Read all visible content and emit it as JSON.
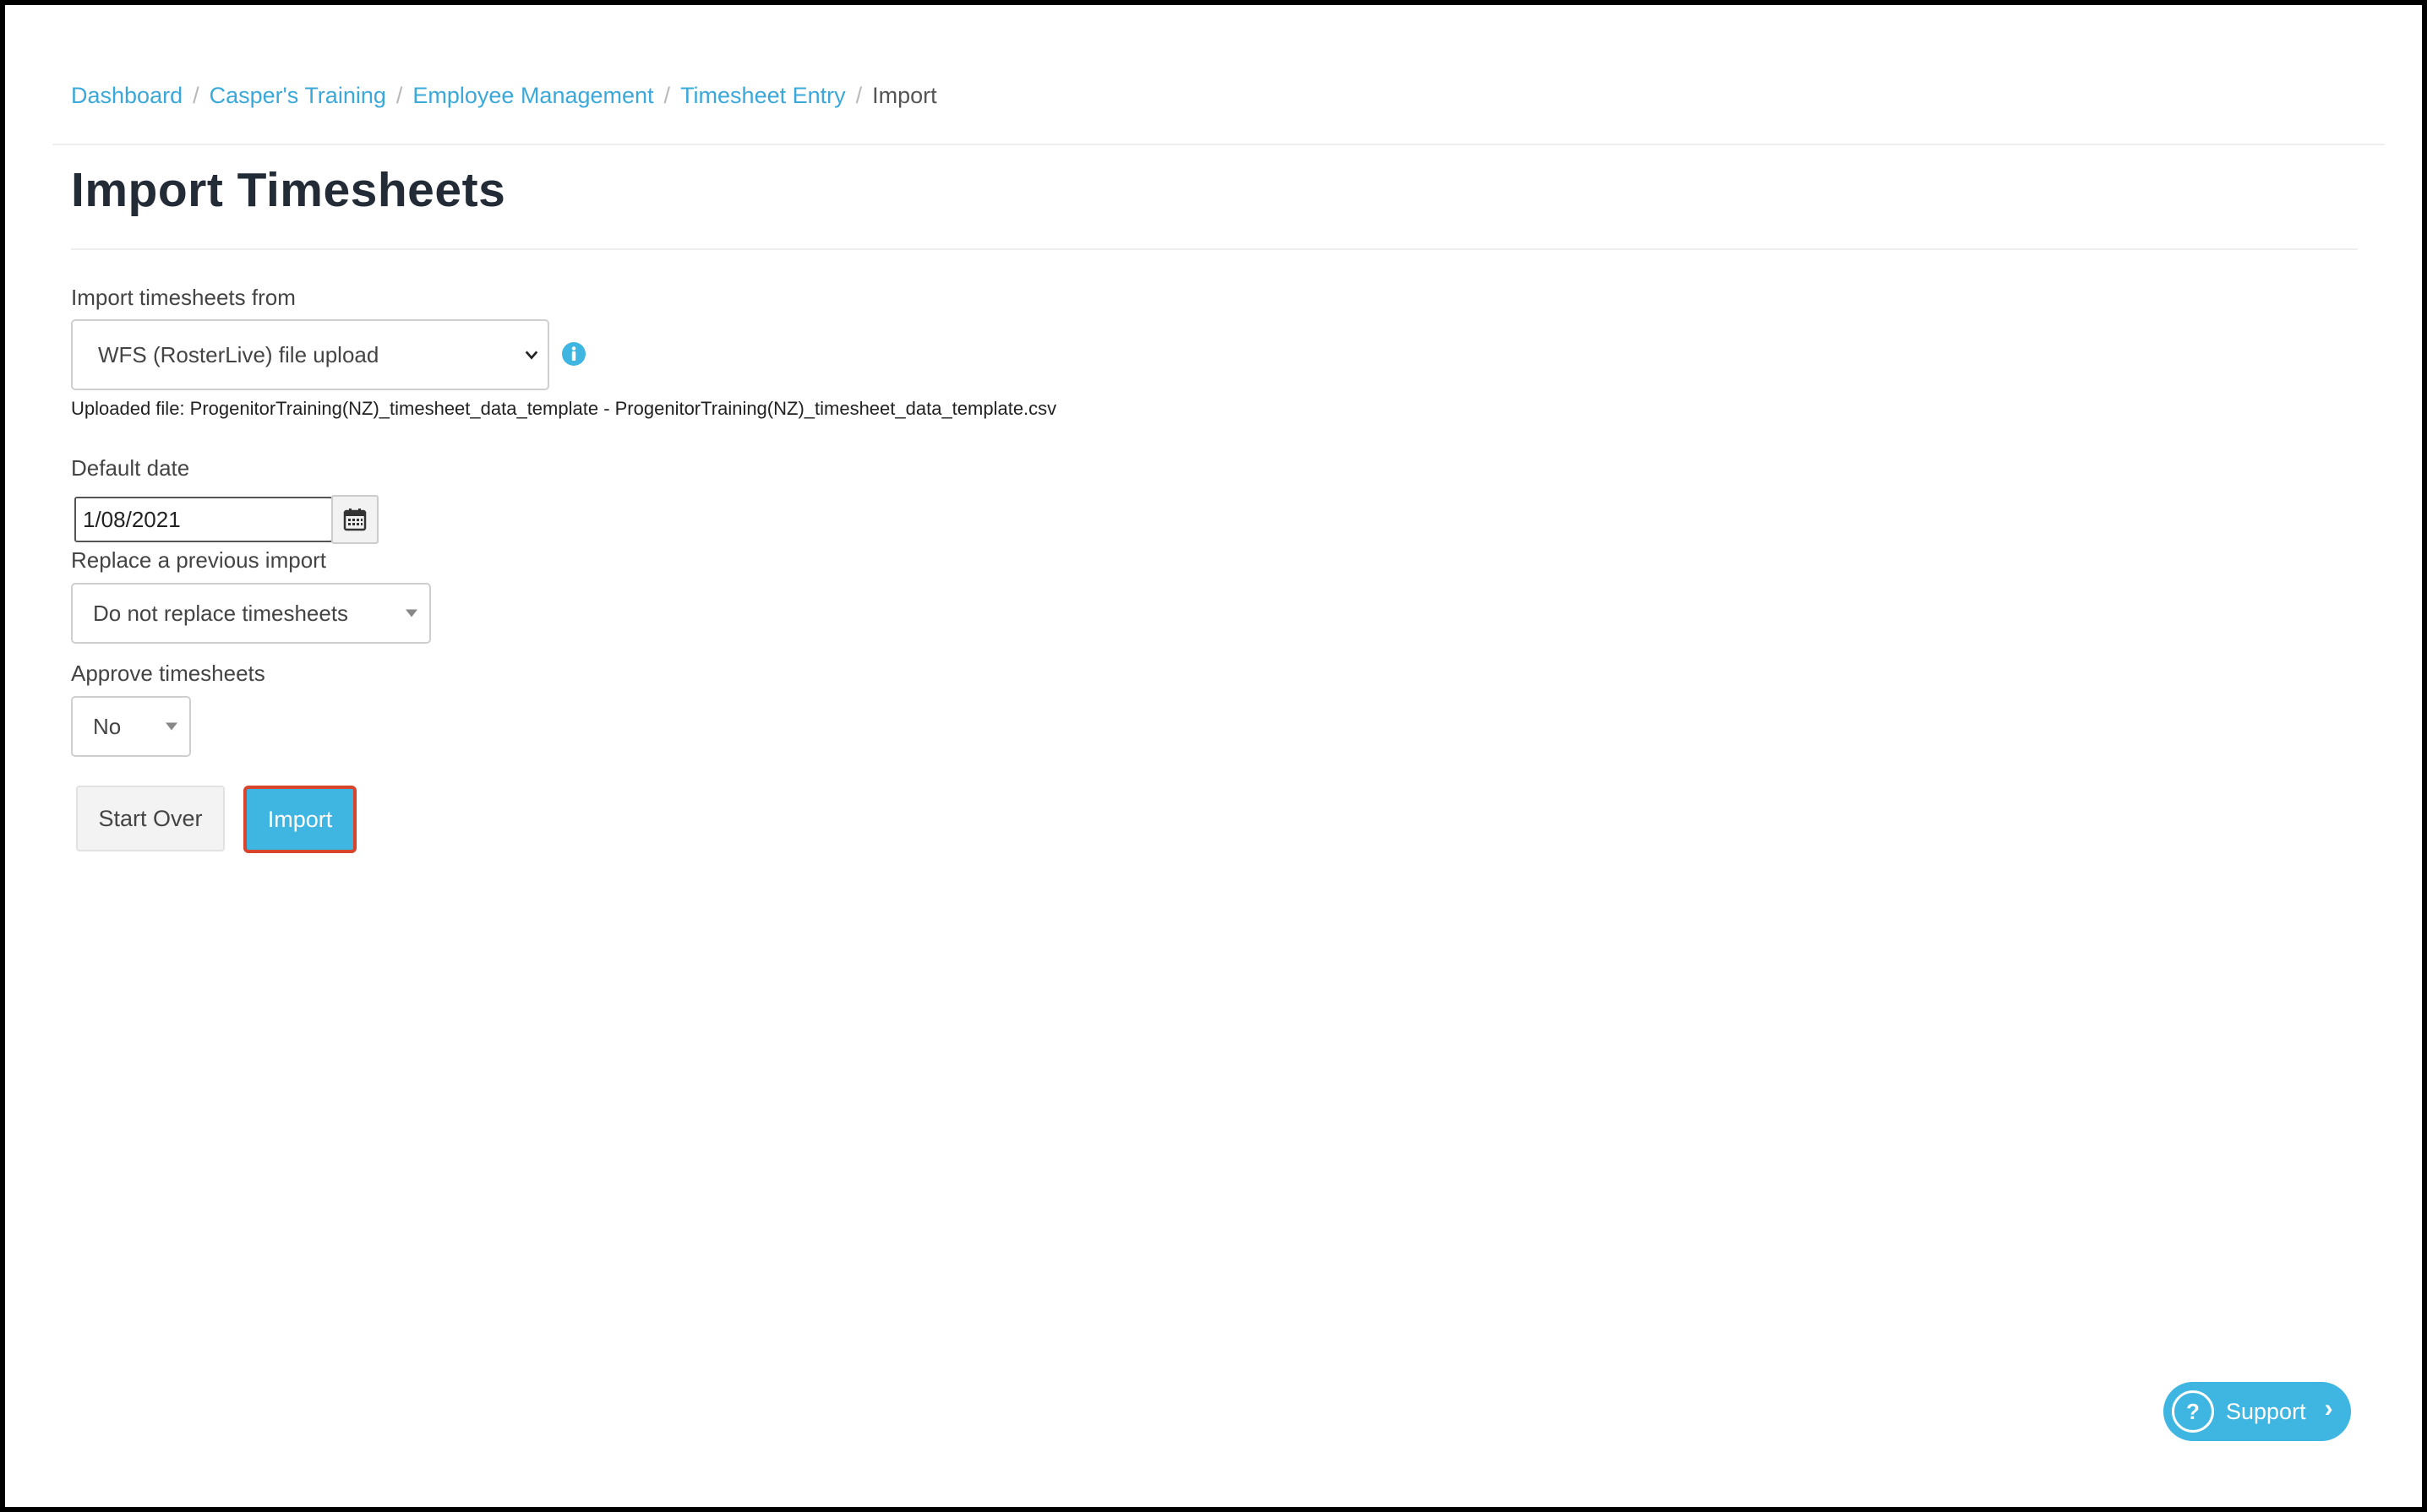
{
  "breadcrumb": {
    "items": [
      "Dashboard",
      "Casper's Training",
      "Employee Management",
      "Timesheet Entry"
    ],
    "current": "Import",
    "separator": "/"
  },
  "page": {
    "title": "Import Timesheets"
  },
  "form": {
    "source_label": "Import timesheets from",
    "source_value": "WFS (RosterLive) file upload",
    "uploaded_file": "Uploaded file: ProgenitorTraining(NZ)_timesheet_data_template - ProgenitorTraining(NZ)_timesheet_data_template.csv",
    "default_date_label": "Default date",
    "default_date_value": "1/08/2021",
    "replace_label": "Replace a previous import",
    "replace_value": "Do not replace timesheets",
    "approve_label": "Approve timesheets",
    "approve_value": "No"
  },
  "buttons": {
    "start_over": "Start Over",
    "import": "Import"
  },
  "support": {
    "label": "Support",
    "q_glyph": "?",
    "arrow_glyph": "›"
  },
  "colors": {
    "accent": "#3fb5e1",
    "link": "#3aa8d8",
    "highlight": "#d8452d"
  },
  "icons": {
    "info": "info-icon",
    "calendar": "calendar-icon",
    "chevron": "chevron-down-icon",
    "help": "help-icon"
  }
}
